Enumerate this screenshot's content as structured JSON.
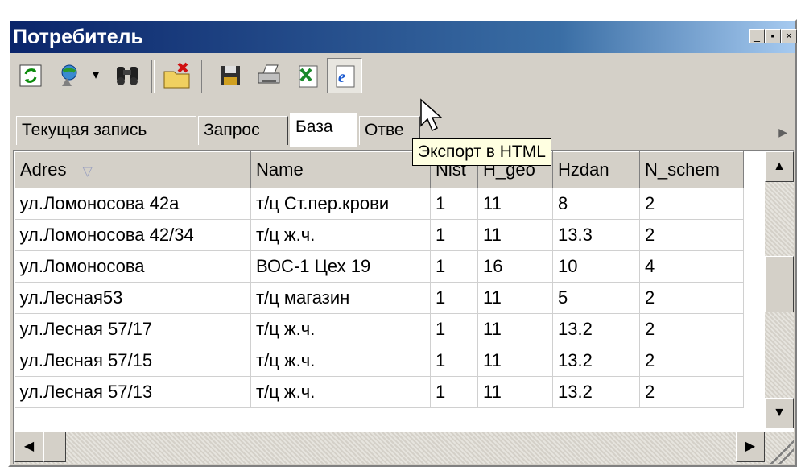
{
  "window": {
    "title": "Потребитель",
    "controls": [
      "_",
      "▪",
      "×"
    ]
  },
  "toolbar": {
    "icons": [
      "refresh-icon",
      "connect-icon",
      "dropdown-arrow-icon",
      "find-binoculars-icon",
      "delete-folder-icon",
      "save-disk-icon",
      "print-icon",
      "export-excel-icon",
      "export-html-icon"
    ]
  },
  "tabs": [
    {
      "label": "Текущая запись",
      "active": false
    },
    {
      "label": "Запрос",
      "active": false
    },
    {
      "label": "База",
      "active": true
    },
    {
      "label": "Отве",
      "active": false
    }
  ],
  "tooltip": {
    "text": "Экспорт в HTML"
  },
  "grid": {
    "columns": [
      "Adres",
      "Name",
      "Nist",
      "H_geo",
      "Hzdan",
      "N_schem"
    ],
    "rows": [
      [
        "ул.Ломоносова 42а",
        "т/ц Ст.пер.крови",
        "1",
        "11",
        "8",
        "2"
      ],
      [
        "ул.Ломоносова 42/34",
        "т/ц ж.ч.",
        "1",
        "11",
        "13.3",
        "2"
      ],
      [
        "ул.Ломоносова",
        "ВОС-1 Цех 19",
        "1",
        "16",
        "10",
        "4"
      ],
      [
        "ул.Лесная53",
        "т/ц магазин",
        "1",
        "11",
        "5",
        "2"
      ],
      [
        "ул.Лесная 57/17",
        "т/ц ж.ч.",
        "1",
        "11",
        "13.2",
        "2"
      ],
      [
        "ул.Лесная 57/15",
        "т/ц ж.ч.",
        "1",
        "11",
        "13.2",
        "2"
      ],
      [
        "ул.Лесная 57/13",
        "т/ц ж.ч.",
        "1",
        "11",
        "13.2",
        "2"
      ]
    ]
  },
  "colors": {
    "titlebar_start": "#0a246a",
    "titlebar_end": "#a6caf0",
    "tooltip_bg": "#ffffe1"
  }
}
